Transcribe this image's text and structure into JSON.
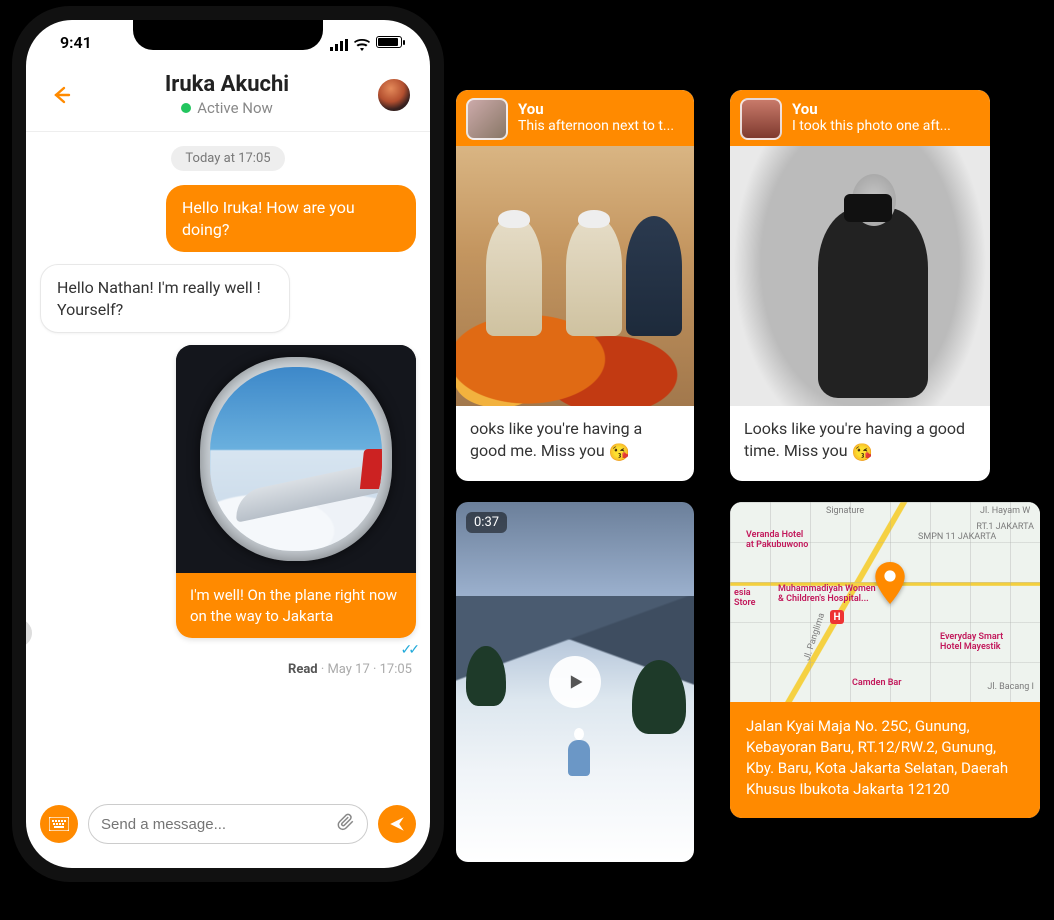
{
  "status_bar": {
    "time": "9:41"
  },
  "header": {
    "contact_name": "Iruka Akuchi",
    "status_text": "Active Now"
  },
  "conversation": {
    "date_chip": "Today at 17:05",
    "msg_out1": "Hello Iruka! How are you doing?",
    "msg_in1": "Hello Nathan! I'm really well ! Yourself?",
    "image_caption": "I'm well! On the plane right now on the way to Jakarta",
    "read_label": "Read",
    "read_meta": " · May 17 · 17:05"
  },
  "composer": {
    "placeholder": "Send a message..."
  },
  "cards": {
    "market": {
      "you_label": "You",
      "preview": "This afternoon next to t...",
      "caption": "ooks like you're having a good me. Miss you "
    },
    "portrait": {
      "you_label": "You",
      "preview": "I took this photo one aft...",
      "caption": "Looks like you're having a good time. Miss you "
    },
    "video": {
      "duration": "0:37"
    },
    "map": {
      "labels": {
        "signature": "Signature",
        "veranda": "Veranda Hotel\nat Pakubuwono",
        "hospital": "Muhammadiyah Women\n& Children's Hospital...",
        "smpn": "SMPN 11 JAKARTA",
        "esia": "esia\nStore",
        "camden": "Camden Bar",
        "mayestik": "Everyday Smart\nHotel Mayestik",
        "hayam": "Jl. Hayam W",
        "jakarta": "RT.1 JAKARTA",
        "bacang": "Jl. Bacang I",
        "panglima": "Jl. Panglima"
      },
      "address": "Jalan Kyai Maja No. 25C, Gunung, Kebayoran Baru, RT.12/RW.2, Gunung, Kby. Baru, Kota Jakarta Selatan, Daerah Khusus Ibukota Jakarta 12120"
    }
  },
  "emoji": "😘"
}
